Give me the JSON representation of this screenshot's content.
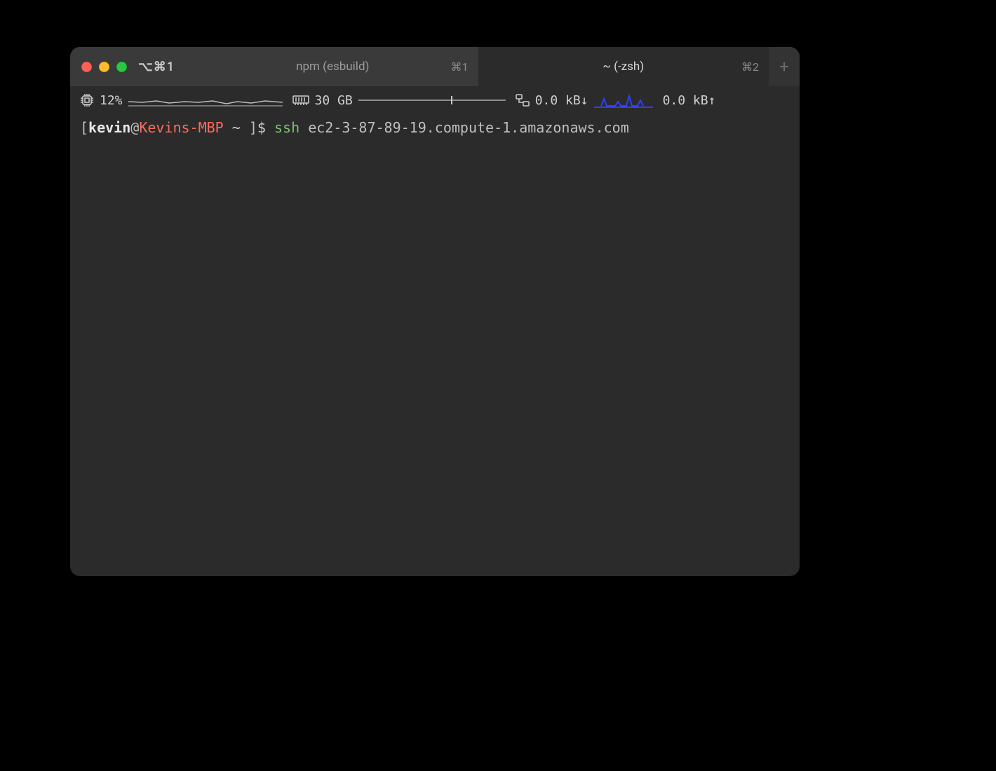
{
  "window": {
    "hotkey_profile": "⌥⌘1",
    "tabs": [
      {
        "title": "npm (esbuild)",
        "shortcut": "⌘1",
        "active": false
      },
      {
        "title": "~ (-zsh)",
        "shortcut": "⌘2",
        "active": true
      }
    ],
    "new_tab_label": "+"
  },
  "status": {
    "cpu": {
      "label": "12%",
      "icon": "cpu-icon"
    },
    "memory": {
      "label": "30 GB",
      "icon": "ram-icon",
      "used_fraction": 0.63
    },
    "net_down": {
      "label": "0.0 kB↓",
      "icon": "net-icon"
    },
    "net_up": {
      "label": "0.0 kB↑"
    }
  },
  "prompt": {
    "open": "[",
    "user": "kevin",
    "at": "@",
    "host": "Kevins-MBP",
    "path": "~",
    "close": "]",
    "symbol": "$"
  },
  "command": {
    "program": "ssh",
    "args": "ec2-3-87-89-19.compute-1.amazonaws.com"
  },
  "colors": {
    "bg": "#2b2b2b",
    "tabbar": "#3a3a3a",
    "text": "#cfcfcf",
    "host_red": "#ff6b5b",
    "cmd_green": "#7cc66f",
    "spark_blue": "#2d40ff"
  }
}
